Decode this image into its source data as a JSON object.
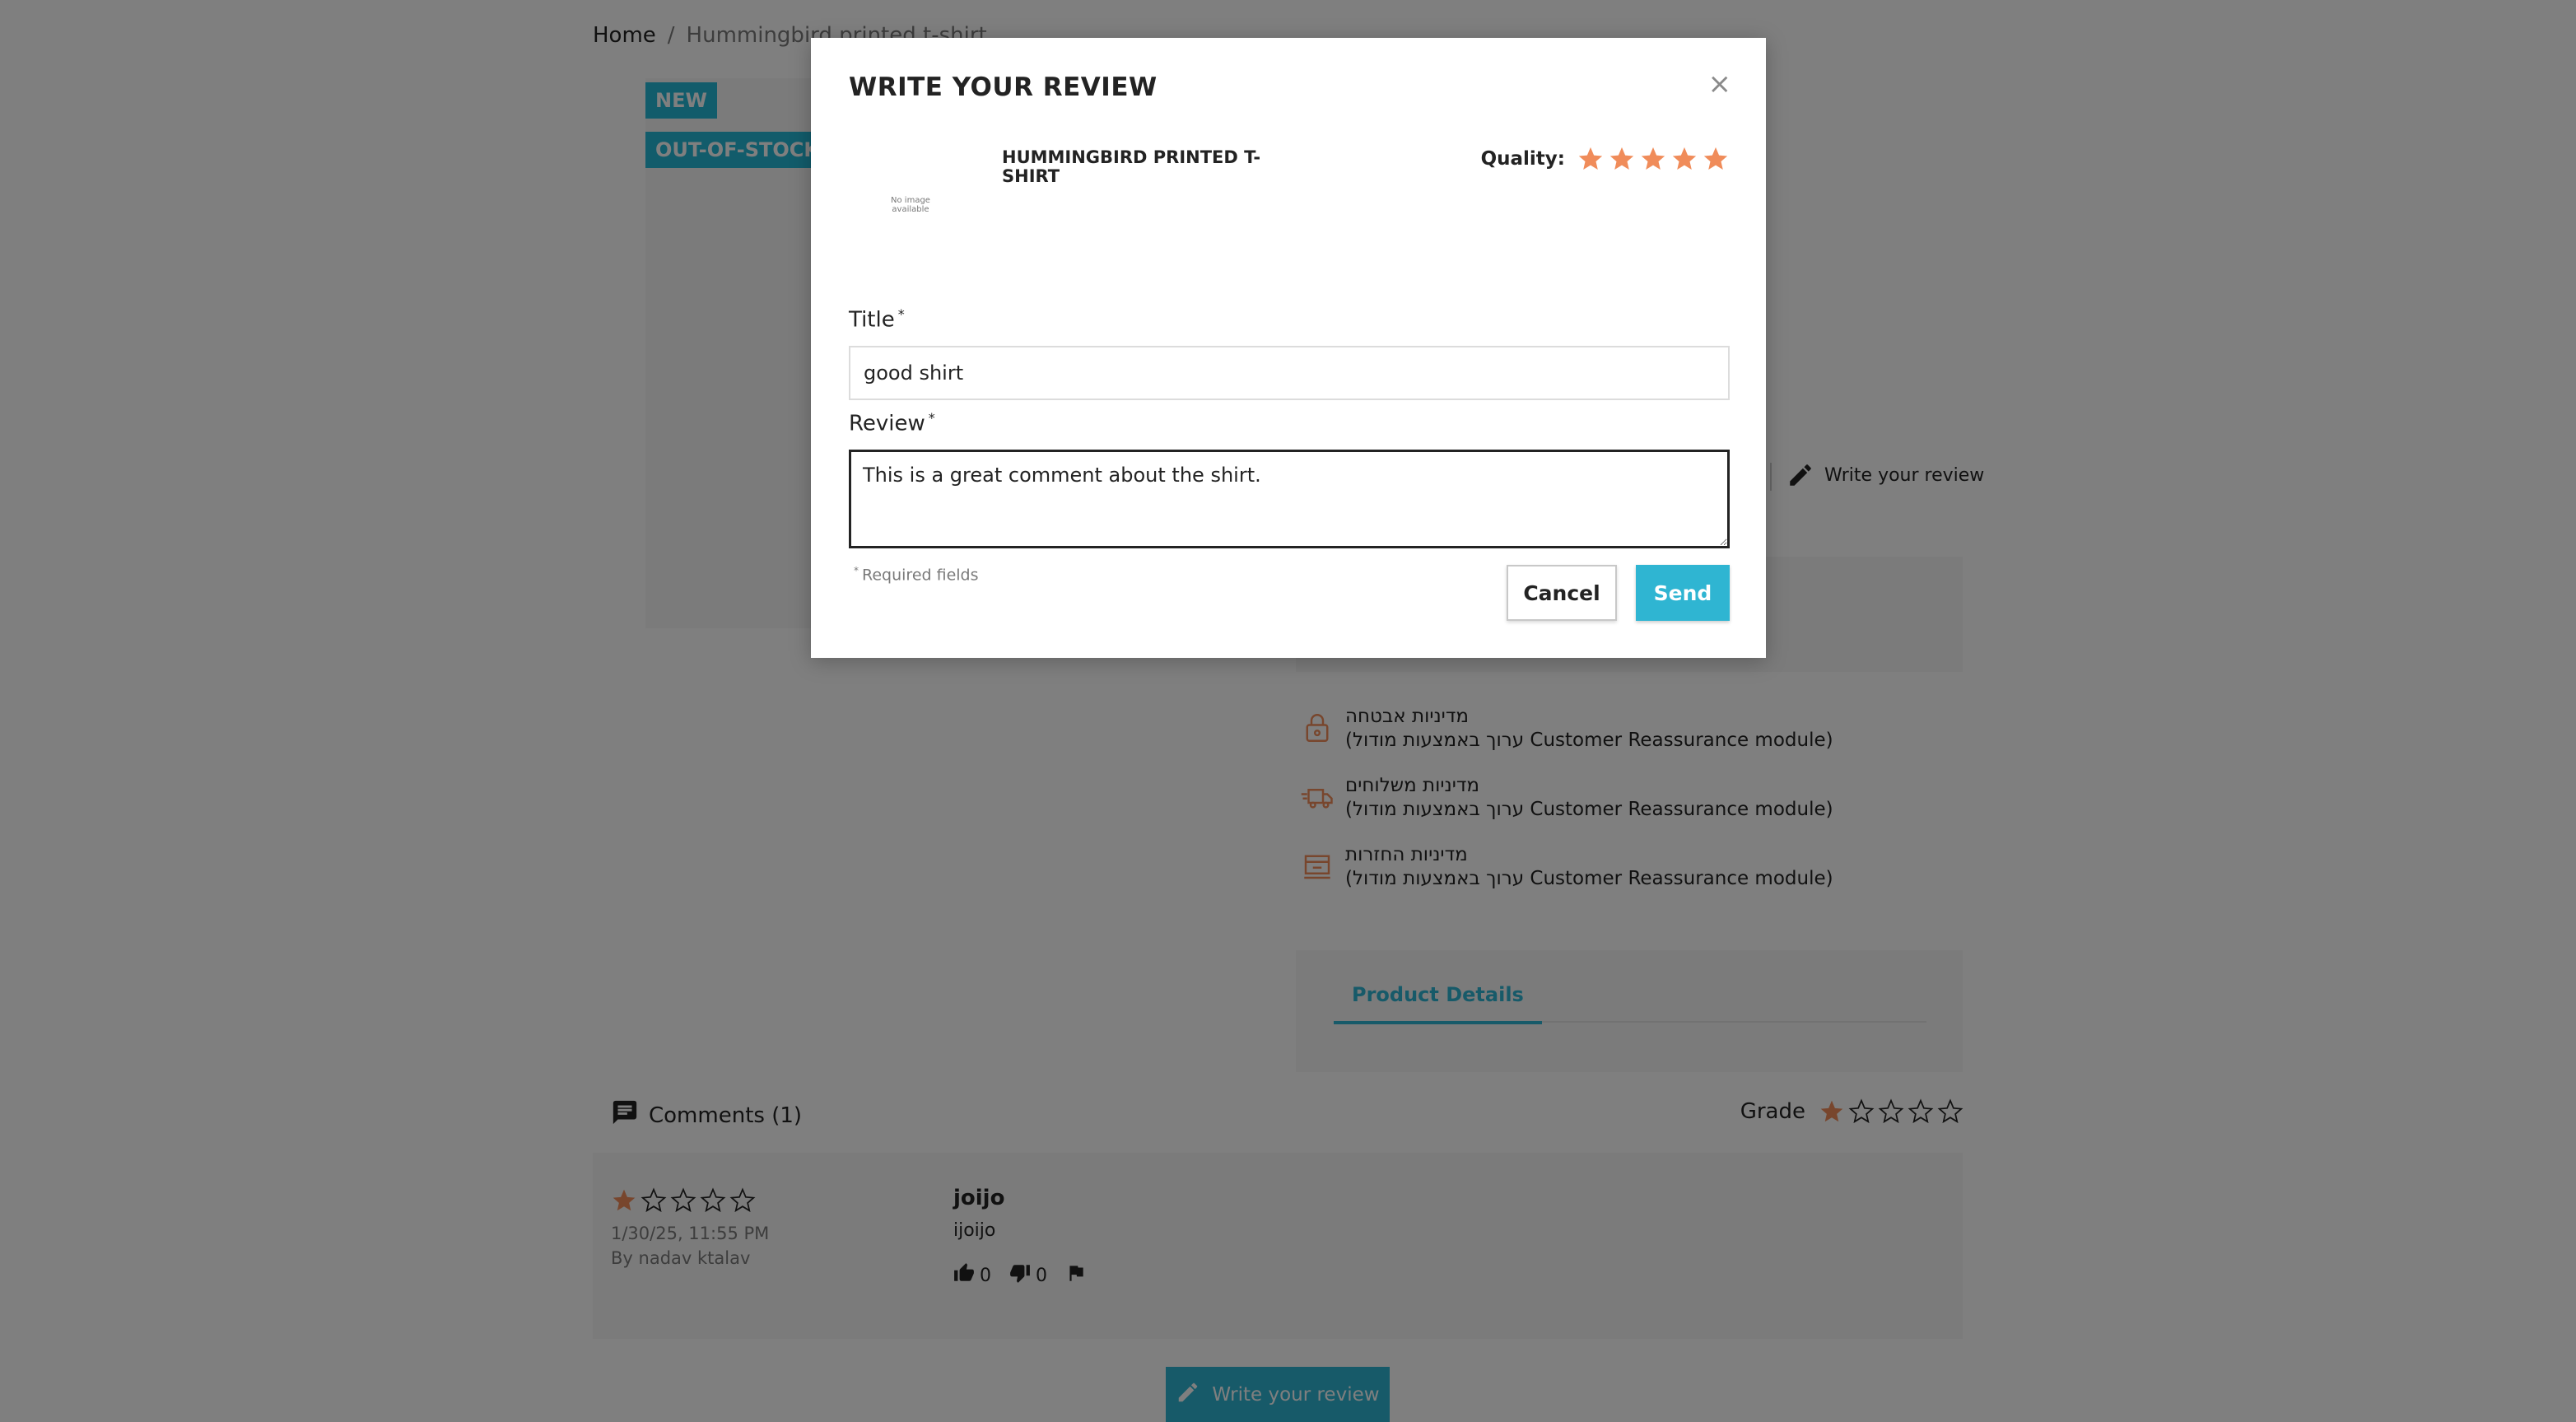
{
  "breadcrumb": {
    "home": "Home",
    "separator": "/",
    "current": "Hummingbird printed t-shirt"
  },
  "flags": {
    "new": "NEW",
    "out_of_stock": "OUT-OF-STOCK"
  },
  "write_review_link": "Write your review",
  "reassurance": [
    {
      "icon": "lock-icon",
      "title": "מדיניות אבטחה",
      "desc": "(ערוך באמצעות מודול Customer Reassurance module)"
    },
    {
      "icon": "truck-icon",
      "title": "מדיניות משלוחים",
      "desc": "(ערוך באמצעות מודול Customer Reassurance module)"
    },
    {
      "icon": "return-icon",
      "title": "מדיניות החזרות",
      "desc": "(ערוך באמצעות מודול Customer Reassurance module)"
    }
  ],
  "tabs": {
    "active": "Product Details"
  },
  "comments": {
    "header": "Comments (1)",
    "grade_label": "Grade",
    "grade": 1,
    "max_grade": 5,
    "items": [
      {
        "rating": 1,
        "date": "1/30/25, 11:55 PM",
        "author": "By nadav ktalav",
        "title": "joijo",
        "body": "ijoijo",
        "useful": "0",
        "not_useful": "0"
      }
    ]
  },
  "bottom_button": "Write your review",
  "modal": {
    "title": "WRITE YOUR REVIEW",
    "close": "×",
    "no_image_text": "No image available",
    "product_name": "HUMMINGBIRD PRINTED T-SHIRT",
    "quality_label": "Quality:",
    "quality_rating": 5,
    "title_label": "Title",
    "title_value": "good shirt",
    "review_label": "Review",
    "review_value": "This is a great comment about the shirt.",
    "required_asterisk": "*",
    "required_note": "Required fields",
    "cancel": "Cancel",
    "send": "Send"
  },
  "colors": {
    "accent": "#2fb5d2",
    "star": "#f08c5a",
    "overlay": "rgba(0,0,0,0.5)"
  }
}
